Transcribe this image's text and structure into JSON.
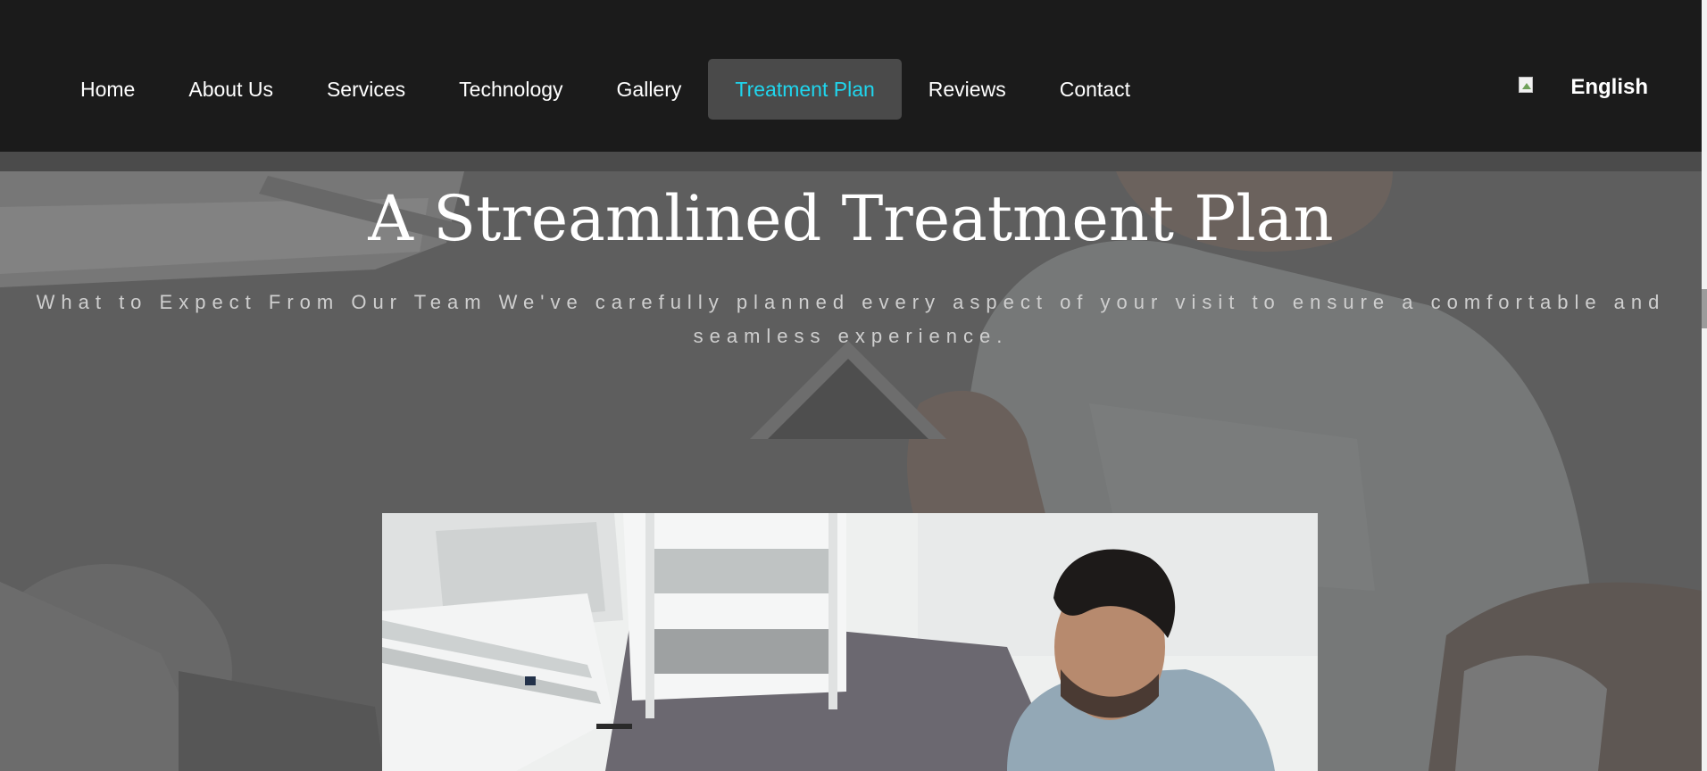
{
  "nav": {
    "items": [
      {
        "label": "Home",
        "active": false
      },
      {
        "label": "About Us",
        "active": false
      },
      {
        "label": "Services",
        "active": false
      },
      {
        "label": "Technology",
        "active": false
      },
      {
        "label": "Gallery",
        "active": false
      },
      {
        "label": "Treatment Plan",
        "active": true
      },
      {
        "label": "Reviews",
        "active": false
      },
      {
        "label": "Contact",
        "active": false
      }
    ]
  },
  "language": {
    "label": "English",
    "icon": "flag-icon"
  },
  "hero": {
    "title": "A Streamlined Treatment Plan",
    "subtitle": "What to Expect From Our Team We've carefully planned every aspect of your visit to ensure a comfortable and seamless experience."
  },
  "colors": {
    "header_bg": "#1b1b1b",
    "active_nav_bg": "#4a4a4a",
    "active_nav_text": "#1fd6ee",
    "nav_text": "#ffffff"
  }
}
